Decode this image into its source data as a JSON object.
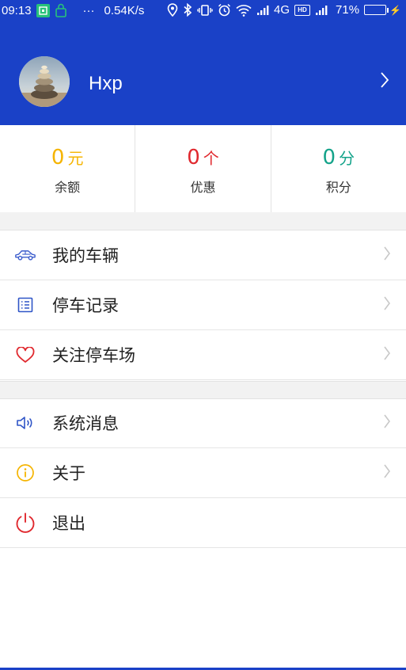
{
  "status_bar": {
    "time": "09:13",
    "speed": "0.54K/s",
    "network": "4G",
    "hd": "HD",
    "battery": "71%",
    "battery_level": 0.71
  },
  "profile": {
    "username": "Hxp"
  },
  "stats": [
    {
      "value": "0",
      "unit": "元",
      "label": "余额",
      "color": "#f5b400"
    },
    {
      "value": "0",
      "unit": "个",
      "label": "优惠",
      "color": "#e0282e"
    },
    {
      "value": "0",
      "unit": "分",
      "label": "积分",
      "color": "#14a38a"
    }
  ],
  "menu_group_1": [
    {
      "label": "我的车辆",
      "icon": "car-icon"
    },
    {
      "label": "停车记录",
      "icon": "list-icon"
    },
    {
      "label": "关注停车场",
      "icon": "heart-icon"
    }
  ],
  "menu_group_2": [
    {
      "label": "系统消息",
      "icon": "speaker-icon"
    },
    {
      "label": "关于",
      "icon": "info-icon"
    },
    {
      "label": "退出",
      "icon": "power-icon"
    }
  ],
  "colors": {
    "header": "#1a41c7",
    "car_icon": "#3b5ccc",
    "list_icon": "#2f55c7",
    "heart_icon": "#e0282e",
    "speaker_icon": "#2f55c7",
    "info_icon": "#f5b400",
    "power_icon": "#e0282e"
  }
}
